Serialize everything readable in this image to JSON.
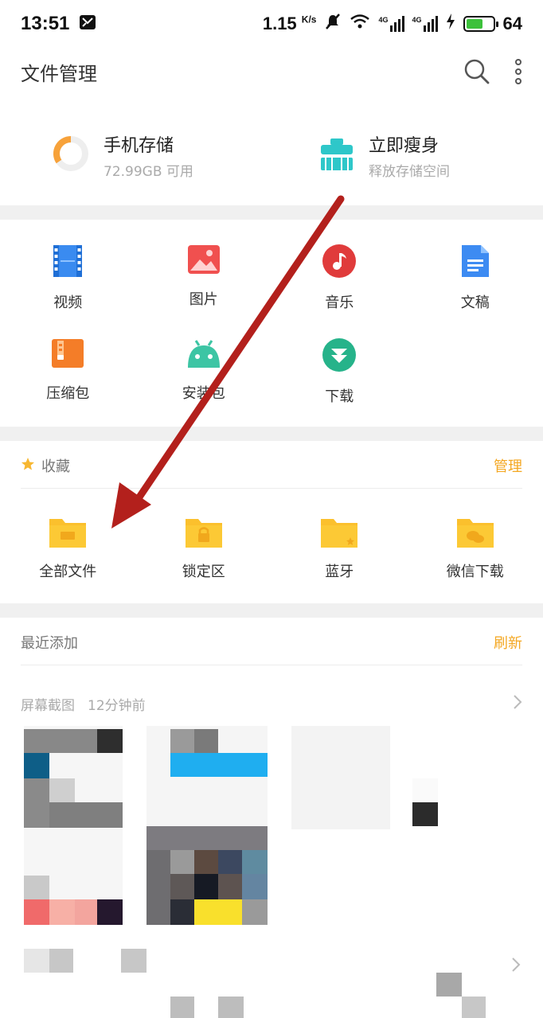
{
  "status": {
    "time": "13:51",
    "speed": "1.15",
    "speed_unit": "K/s",
    "net1": "4G",
    "net2": "4G",
    "battery": "64",
    "battery_level": 0.64
  },
  "header": {
    "title": "文件管理"
  },
  "storage": {
    "phone": {
      "title": "手机存储",
      "sub": "72.99GB 可用"
    },
    "slim": {
      "title": "立即瘦身",
      "sub": "释放存储空间"
    }
  },
  "categories": [
    {
      "label": "视频"
    },
    {
      "label": "图片"
    },
    {
      "label": "音乐"
    },
    {
      "label": "文稿"
    },
    {
      "label": "压缩包"
    },
    {
      "label": "安装包"
    },
    {
      "label": "下载"
    }
  ],
  "favorites": {
    "title": "收藏",
    "action": "管理",
    "items": [
      {
        "label": "全部文件"
      },
      {
        "label": "锁定区"
      },
      {
        "label": "蓝牙"
      },
      {
        "label": "微信下载"
      }
    ]
  },
  "recent": {
    "title": "最近添加",
    "action": "刷新",
    "group": {
      "title": "屏幕截图",
      "time": "12分钟前"
    }
  },
  "colors": {
    "accent": "#f4a721",
    "folder": "#fbc02d",
    "arrow": "#b3201c"
  }
}
